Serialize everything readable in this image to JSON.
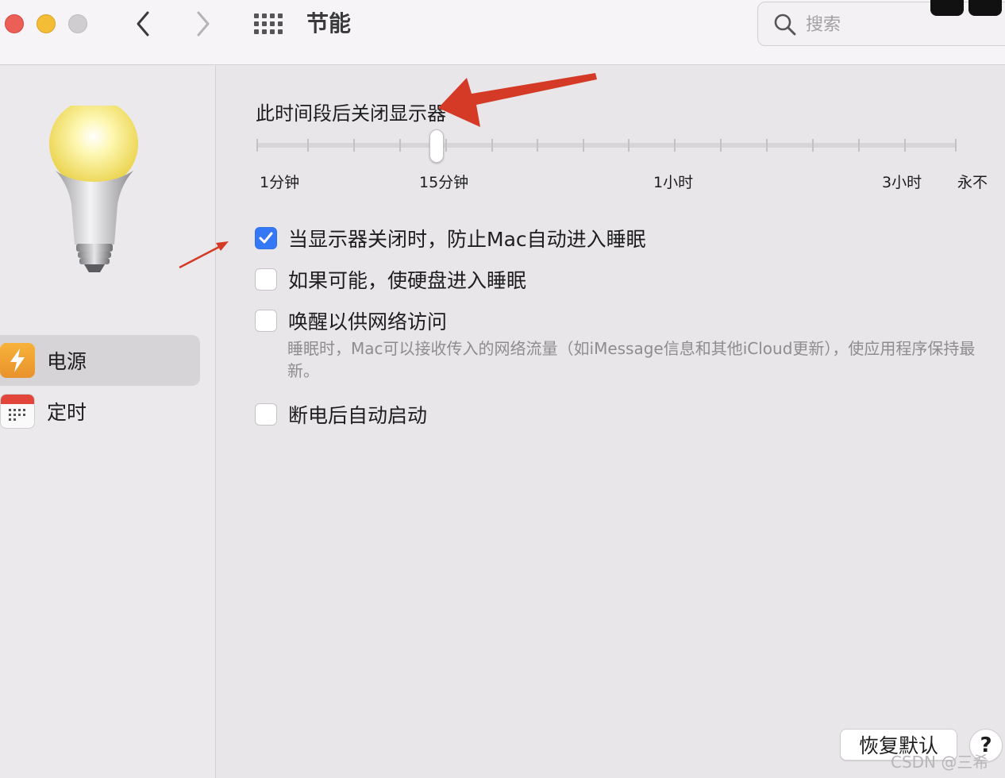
{
  "window": {
    "title": "节能",
    "buttons": [
      "close",
      "minimize",
      "zoom"
    ]
  },
  "toolbar": {
    "back_icon": "chevron-left-icon",
    "forward_icon": "chevron-right-icon",
    "show_all_icon": "grid-icon"
  },
  "search": {
    "placeholder": "搜索",
    "value": ""
  },
  "sidebar": {
    "items": [
      {
        "label": "电源",
        "icon": "power-bolt-icon",
        "selected": true
      },
      {
        "label": "定时",
        "icon": "calendar-icon",
        "selected": false
      }
    ]
  },
  "display_sleep": {
    "title": "此时间段后关闭显示器",
    "labels": [
      "1分钟",
      "15分钟",
      "1小时",
      "3小时",
      "永不"
    ],
    "selected_label": "15分钟"
  },
  "options": [
    {
      "label": "当显示器关闭时，防止Mac自动进入睡眠",
      "checked": true
    },
    {
      "label": "如果可能，使硬盘进入睡眠",
      "checked": false
    },
    {
      "label": "唤醒以供网络访问",
      "checked": false,
      "description": "睡眠时，Mac可以接收传入的网络流量（如iMessage信息和其他iCloud更新），使应用程序保持最新。"
    },
    {
      "label": "断电后自动启动",
      "checked": false
    }
  ],
  "footer": {
    "restore_label": "恢复默认",
    "help_label": "?"
  },
  "watermark": "CSDN @三希",
  "colors": {
    "accent": "#3478f6",
    "annotation_arrow": "#d43a26"
  }
}
